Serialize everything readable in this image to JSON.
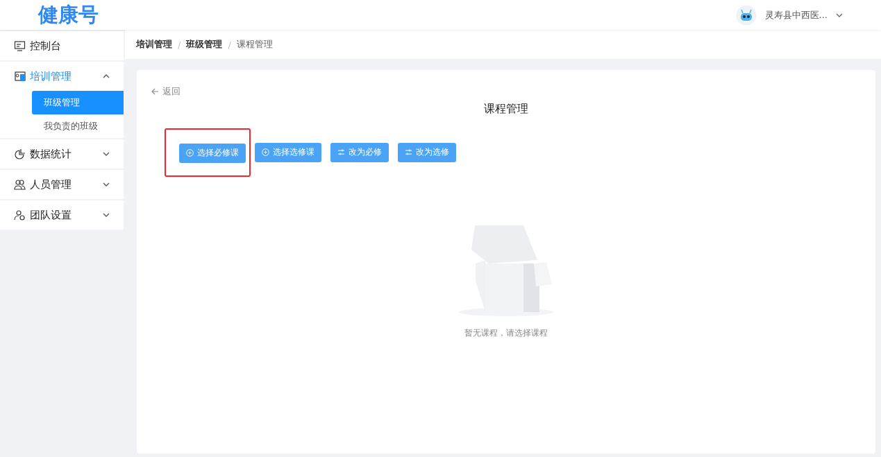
{
  "header": {
    "logo": "健康号",
    "user": "灵寿县中西医..."
  },
  "sidebar": {
    "items": [
      {
        "label": "控制台",
        "selected": false
      },
      {
        "label": "培训管理",
        "selected": true,
        "expanded": true,
        "children": [
          {
            "label": "班级管理",
            "selected": true
          },
          {
            "label": "我负责的班级",
            "selected": false
          }
        ]
      },
      {
        "label": "数据统计",
        "selected": false,
        "expanded": false
      },
      {
        "label": "人员管理",
        "selected": false,
        "expanded": false
      },
      {
        "label": "团队设置",
        "selected": false,
        "expanded": false
      }
    ]
  },
  "breadcrumb": [
    {
      "label": "培训管理",
      "current": false
    },
    {
      "separator": "/",
      "label": "班级管理",
      "current": false
    },
    {
      "separator": "/",
      "label": "课程管理",
      "current": true
    }
  ],
  "back": "返回",
  "title": "课程管理",
  "buttons": [
    {
      "label": "选择必修课",
      "kind": "add",
      "highlighted": true
    },
    {
      "label": "选择选修课",
      "kind": "add",
      "highlighted": false
    },
    {
      "label": "改为必修",
      "kind": "switch",
      "highlighted": false
    },
    {
      "label": "改为选修",
      "kind": "switch",
      "highlighted": false
    }
  ],
  "empty": "暂无课程，请选择课程"
}
